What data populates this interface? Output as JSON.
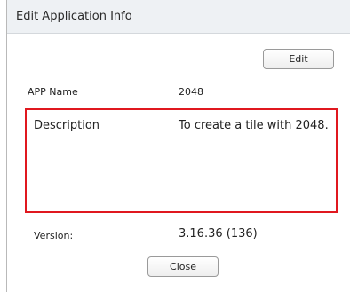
{
  "dialog": {
    "title": "Edit Application Info",
    "edit_label": "Edit",
    "close_label": "Close"
  },
  "fields": {
    "app_name_label": "APP Name",
    "app_name_value": "2048",
    "description_label": "Description",
    "description_value": "To create a tile with 2048.",
    "version_label": "Version:",
    "version_value": "3.16.36 (136)"
  },
  "colors": {
    "highlight_border": "#e0181f",
    "titlebar_bg": "#eef1f4"
  }
}
